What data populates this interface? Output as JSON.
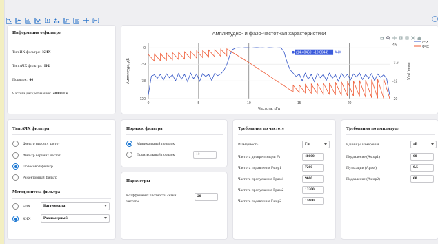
{
  "colors": {
    "accent": "#1976d2",
    "amplitude": "#3557c7",
    "phase": "#ef5b35",
    "highlight": "#3b5bdb"
  },
  "toolbar": {
    "icons": [
      "bode-plot-icon",
      "log-plot-icon",
      "grid-plot-icon",
      "frequency-plot-icon",
      "impulse-plot-icon",
      "pole-zero-icon",
      "step-plot-icon",
      "coefficients-icon",
      "crosshair-icon",
      "filter-info-icon"
    ]
  },
  "info": {
    "title": "Информация о фильтре",
    "rows": [
      {
        "label": "Тип ИХ фильтра:",
        "value": "КИХ"
      },
      {
        "label": "Тип АЧХ фильтра:",
        "value": "ПФ"
      },
      {
        "label": "Порядок:",
        "value": "44"
      },
      {
        "label": "Частота дискретизации:",
        "value": "48000 Гц"
      }
    ]
  },
  "chart_data": {
    "type": "line",
    "title": "Амплитудно- и фазо-частотная характеристики",
    "xlabel": "Частота, кГц",
    "ylabel": "Амплитуда, дБ",
    "y2label": "Фаза, рад",
    "xlim": [
      0,
      24
    ],
    "ylim": [
      -120,
      10
    ],
    "y2lim": [
      -20,
      5
    ],
    "xticks": [
      "0",
      "5",
      "10",
      "15",
      "20"
    ],
    "yticks": [
      "0",
      "-39",
      "-78",
      "-120"
    ],
    "y2ticks": [
      "4.6",
      "-3.6",
      "-12",
      "-20"
    ],
    "legend": "top-right",
    "series": [
      {
        "name": "АЧХ",
        "color": "#3557c7",
        "x": [
          0,
          0.3,
          0.6,
          0.9,
          1.2,
          1.5,
          1.8,
          2.1,
          2.4,
          2.7,
          3.0,
          3.3,
          3.6,
          3.9,
          4.2,
          4.5,
          4.8,
          5.1,
          5.4,
          5.7,
          6.0,
          6.3,
          6.6,
          6.9,
          7.2,
          7.5,
          7.8,
          8.1,
          8.4,
          8.7,
          9.0,
          9.3,
          9.6,
          9.9,
          10.2,
          10.5,
          10.8,
          11.1,
          11.4,
          11.7,
          12.0,
          12.3,
          12.6,
          12.9,
          13.2,
          13.5,
          13.8,
          14.1,
          14.4,
          14.7,
          15.0,
          15.3,
          15.6,
          15.9,
          16.2,
          16.5,
          16.8,
          17.1,
          17.4,
          17.7,
          18.0,
          18.3,
          18.6,
          18.9,
          19.2,
          19.5,
          19.8,
          20.1,
          20.4,
          20.7,
          21.0,
          21.3,
          21.6,
          21.9,
          22.2,
          22.5,
          22.8,
          23.1,
          23.4,
          23.7,
          24.0
        ],
        "y": [
          -112,
          -67,
          -64,
          -72,
          -63,
          -76,
          -62,
          -71,
          -64,
          -78,
          -61,
          -74,
          -63,
          -80,
          -60,
          -73,
          -62,
          -79,
          -61,
          -68,
          -63,
          -77,
          -60,
          -66,
          -62,
          -54,
          -40,
          -18,
          -4,
          -0.4,
          0,
          -0.5,
          0.2,
          0.3,
          -0.6,
          -0.1,
          0.4,
          -0.3,
          0,
          -0.5,
          0.2,
          0.1,
          -0.6,
          -0.2,
          0,
          -10.66,
          -35,
          -52,
          -60,
          -68,
          -62,
          -78,
          -60,
          -74,
          -63,
          -80,
          -61,
          -71,
          -63,
          -77,
          -60,
          -72,
          -64,
          -79,
          -61,
          -70,
          -63,
          -76,
          -62,
          -69,
          -60,
          -75,
          -63,
          -72,
          -61,
          -78,
          -62,
          -70,
          -64,
          -73,
          -112
        ]
      },
      {
        "name": "ФЧХ",
        "color": "#ef5b35",
        "x": [
          0,
          0.6,
          0.6,
          1.2,
          1.2,
          1.8,
          1.8,
          2.4,
          2.4,
          3.0,
          3.0,
          3.6,
          3.6,
          4.2,
          4.2,
          4.8,
          4.8,
          5.4,
          5.4,
          6.0,
          6.0,
          6.6,
          6.6,
          7.2,
          7.2,
          7.8,
          7.8,
          8.4,
          9.5,
          10.5,
          11.5,
          12.5,
          13.5,
          14.4,
          14.4,
          15.0,
          15.0,
          15.6,
          15.6,
          16.2,
          16.2,
          16.8,
          16.8,
          17.4,
          17.4,
          18.0,
          18.0,
          18.6,
          18.6,
          19.2,
          19.2,
          19.8,
          19.8,
          20.4,
          20.4,
          21.0,
          21.0,
          21.6,
          21.6,
          22.2,
          22.2,
          22.8,
          22.8,
          23.4,
          23.4,
          24.0
        ],
        "y": [
          0,
          -3,
          0.2,
          -2.8,
          0.4,
          -2.6,
          0.6,
          -2.4,
          0.8,
          -2.2,
          1.0,
          -2.0,
          1.2,
          -1.8,
          1.4,
          -1.6,
          1.6,
          -1.4,
          1.8,
          -1.2,
          2.0,
          -1.0,
          2.2,
          -0.8,
          2.4,
          -0.6,
          2.6,
          0.8,
          -2.2,
          -5.2,
          -8.2,
          -11.2,
          -14.2,
          -17.0,
          -14.0,
          -17.2,
          -13.8,
          -17.4,
          -13.6,
          -17.6,
          -13.4,
          -17.8,
          -13.2,
          -18.0,
          -13.0,
          -18.2,
          -12.8,
          -18.4,
          -12.6,
          -18.6,
          -12.4,
          -18.8,
          -12.2,
          -19.0,
          -12.0,
          -19.2,
          -11.8,
          -19.4,
          -11.6,
          -19.6,
          -11.4,
          -19.8,
          -11.2,
          -20.0,
          -11.0,
          -20.0
        ]
      }
    ],
    "annotation": {
      "text": "(14.40469, -10.6644)",
      "series": "АЧХ",
      "x": 14.40469,
      "y": -10.6644
    }
  },
  "type_panel": {
    "title": "Тип АЧХ фильтра",
    "options": [
      {
        "label": "Фильтр нижних частот",
        "selected": false
      },
      {
        "label": "Фильтр верхних частот",
        "selected": false
      },
      {
        "label": "Полосовой фильтр",
        "selected": true
      },
      {
        "label": "Режекторный фильтр",
        "selected": false
      }
    ],
    "method_title": "Метод синтеза фильтра",
    "methods": [
      {
        "label": "БИХ",
        "select": "Баттерворта",
        "selected": false
      },
      {
        "label": "КИХ",
        "select": "Равномерный",
        "selected": true
      }
    ]
  },
  "order_panel": {
    "title": "Порядок фильтра",
    "options": [
      {
        "label": "Минимальный порядок",
        "selected": true
      },
      {
        "label": "Произвольный порядок",
        "selected": false,
        "value": "10"
      }
    ]
  },
  "params_panel": {
    "title": "Параметры",
    "label": "Коэффициент плотности сетки частоты",
    "value": "20"
  },
  "freq_panel": {
    "title": "Требования по частоте",
    "rows": [
      {
        "label": "Размерность",
        "value": "Гц",
        "type": "select"
      },
      {
        "label": "Частота дискретизации Fs",
        "value": "48000"
      },
      {
        "label": "Частота подавления Fstop1",
        "value": "7200"
      },
      {
        "label": "Частота пропускания Fpass1",
        "value": "9600"
      },
      {
        "label": "Частота пропускания Fpass2",
        "value": "13200"
      },
      {
        "label": "Частота подавления Fstop2",
        "value": "15600"
      }
    ]
  },
  "amp_panel": {
    "title": "Требования по амплитуде",
    "rows": [
      {
        "label": "Единицы измерения",
        "value": "дБ",
        "type": "select"
      },
      {
        "label": "Подавление (Astop1)",
        "value": "60"
      },
      {
        "label": "Пульсации (Apass)",
        "value": "0.5"
      },
      {
        "label": "Подавление (Astop2)",
        "value": "60"
      }
    ]
  }
}
